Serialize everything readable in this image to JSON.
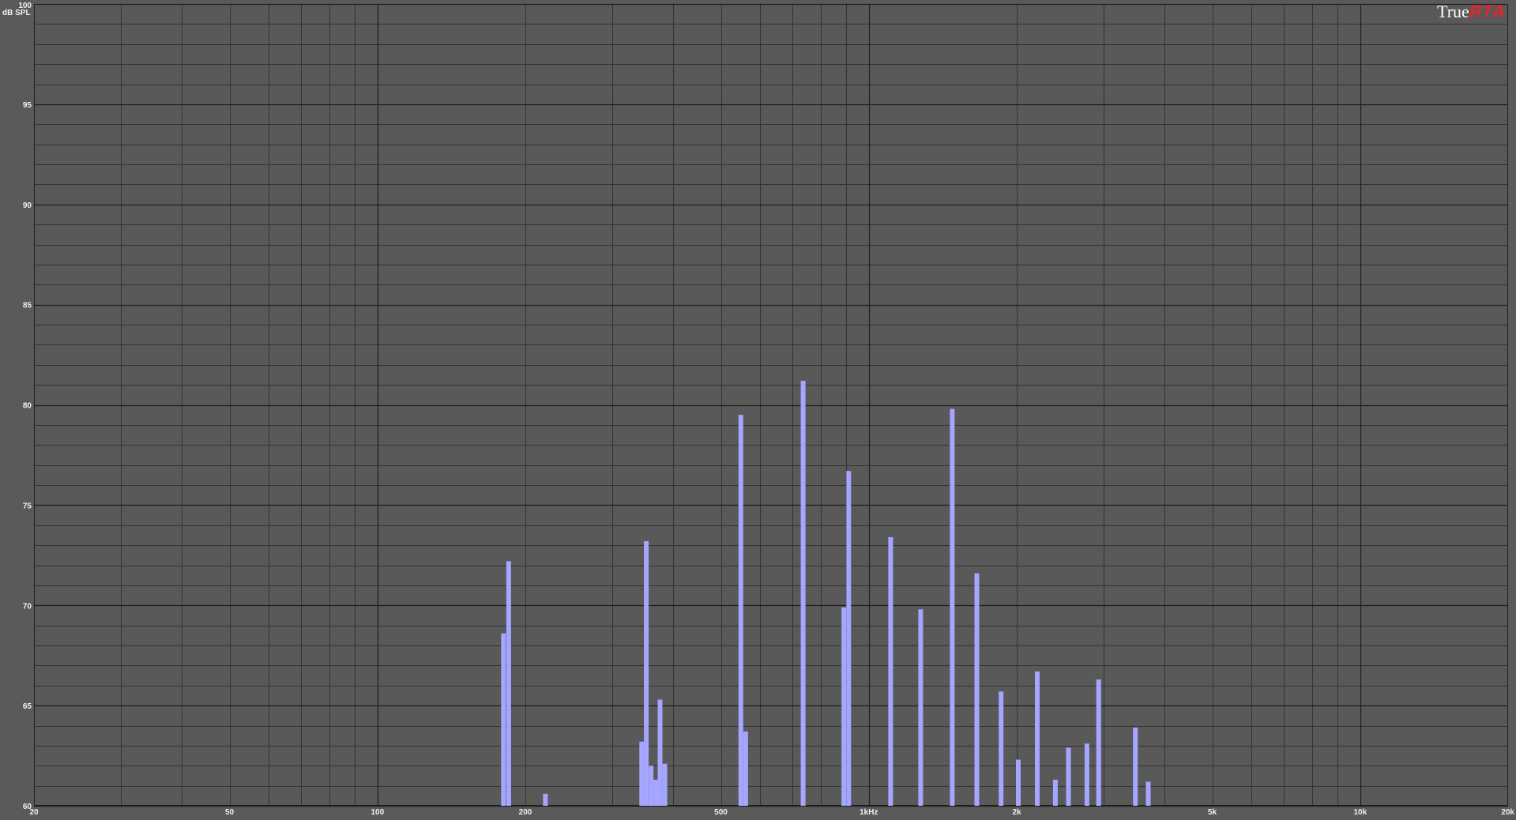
{
  "app": {
    "brand_true": "True",
    "brand_rta": "RTA"
  },
  "colors": {
    "background": "#5a5a5a",
    "plot_area": "#595959",
    "bar": "#a4a6ff",
    "major_grid": "#1f1f1f",
    "minor_grid": "#333333",
    "tick_text": "#f0f0f0",
    "brand_red": "#e3262d"
  },
  "chart_data": {
    "type": "bar",
    "title": "",
    "xlabel": "",
    "ylabel": "dB SPL",
    "x_scale": "log",
    "xlim": [
      20,
      20000
    ],
    "ylim": [
      60,
      100
    ],
    "grid": true,
    "x_ticks": [
      {
        "value": 20,
        "label": "20"
      },
      {
        "value": 50,
        "label": "50"
      },
      {
        "value": 100,
        "label": "100"
      },
      {
        "value": 200,
        "label": "200"
      },
      {
        "value": 500,
        "label": "500"
      },
      {
        "value": 1000,
        "label": "1kHz"
      },
      {
        "value": 2000,
        "label": "2k"
      },
      {
        "value": 5000,
        "label": "5k"
      },
      {
        "value": 10000,
        "label": "10k"
      },
      {
        "value": 20000,
        "label": "20k"
      }
    ],
    "y_ticks": [
      {
        "value": 60,
        "label": "60"
      },
      {
        "value": 65,
        "label": "65"
      },
      {
        "value": 70,
        "label": "70"
      },
      {
        "value": 75,
        "label": "75"
      },
      {
        "value": 80,
        "label": "80"
      },
      {
        "value": 85,
        "label": "85"
      },
      {
        "value": 90,
        "label": "90"
      },
      {
        "value": 95,
        "label": "95"
      },
      {
        "value": 100,
        "label": "100"
      }
    ],
    "bars": [
      {
        "freq": 180.5,
        "value": 68.6
      },
      {
        "freq": 185.0,
        "value": 72.2
      },
      {
        "freq": 219.7,
        "value": 60.6
      },
      {
        "freq": 345.0,
        "value": 63.2
      },
      {
        "freq": 352.5,
        "value": 73.2
      },
      {
        "freq": 360.6,
        "value": 62.0
      },
      {
        "freq": 368.7,
        "value": 61.3
      },
      {
        "freq": 375.9,
        "value": 65.3
      },
      {
        "freq": 384.6,
        "value": 62.1
      },
      {
        "freq": 549.0,
        "value": 79.5
      },
      {
        "freq": 561.5,
        "value": 63.7
      },
      {
        "freq": 734.9,
        "value": 81.2
      },
      {
        "freq": 889.8,
        "value": 69.9
      },
      {
        "freq": 910.0,
        "value": 76.7
      },
      {
        "freq": 1107.6,
        "value": 73.4
      },
      {
        "freq": 1275.0,
        "value": 69.8
      },
      {
        "freq": 1478.8,
        "value": 79.8
      },
      {
        "freq": 1659.0,
        "value": 71.6
      },
      {
        "freq": 1858.5,
        "value": 65.7
      },
      {
        "freq": 2014.5,
        "value": 62.3
      },
      {
        "freq": 2202.1,
        "value": 66.7
      },
      {
        "freq": 2396.6,
        "value": 61.3
      },
      {
        "freq": 2549.2,
        "value": 62.9
      },
      {
        "freq": 2779.3,
        "value": 63.1
      },
      {
        "freq": 2935.7,
        "value": 66.3
      },
      {
        "freq": 3487.0,
        "value": 63.9
      },
      {
        "freq": 3704.9,
        "value": 61.2
      }
    ]
  }
}
